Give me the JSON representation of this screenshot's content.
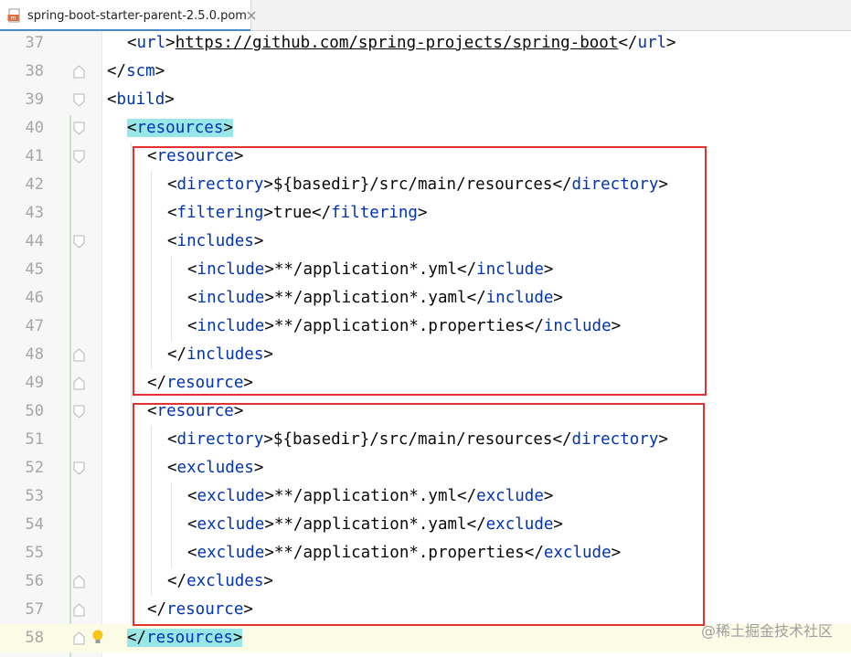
{
  "tab": {
    "title": "spring-boot-starter-parent-2.5.0.pom",
    "icon": "maven-pom-icon"
  },
  "lines": [
    {
      "num": "37",
      "indent": 1,
      "parts": [
        {
          "t": "<",
          "c": "p"
        },
        {
          "t": "url",
          "c": "tag"
        },
        {
          "t": ">",
          "c": "p"
        },
        {
          "t": "https://github.com/spring-projects/spring-boot",
          "c": "url"
        },
        {
          "t": "</",
          "c": "p"
        },
        {
          "t": "url",
          "c": "tag"
        },
        {
          "t": ">",
          "c": "p"
        }
      ]
    },
    {
      "num": "38",
      "indent": 0,
      "fold": "end",
      "parts": [
        {
          "t": "</",
          "c": "p"
        },
        {
          "t": "scm",
          "c": "tag"
        },
        {
          "t": ">",
          "c": "p"
        }
      ]
    },
    {
      "num": "39",
      "indent": 0,
      "fold": "start",
      "parts": [
        {
          "t": "<",
          "c": "p"
        },
        {
          "t": "build",
          "c": "tag"
        },
        {
          "t": ">",
          "c": "p"
        }
      ]
    },
    {
      "num": "40",
      "indent": 1,
      "fold": "start",
      "parts": [
        {
          "t": "<resources>",
          "c": "taghl"
        }
      ]
    },
    {
      "num": "41",
      "indent": 2,
      "fold": "start",
      "parts": [
        {
          "t": "<",
          "c": "p"
        },
        {
          "t": "resource",
          "c": "tag"
        },
        {
          "t": ">",
          "c": "p"
        }
      ]
    },
    {
      "num": "42",
      "indent": 3,
      "parts": [
        {
          "t": "<",
          "c": "p"
        },
        {
          "t": "directory",
          "c": "tag"
        },
        {
          "t": ">${basedir}/src/main/resources</",
          "c": "p"
        },
        {
          "t": "directory",
          "c": "tag"
        },
        {
          "t": ">",
          "c": "p"
        }
      ]
    },
    {
      "num": "43",
      "indent": 3,
      "parts": [
        {
          "t": "<",
          "c": "p"
        },
        {
          "t": "filtering",
          "c": "tag"
        },
        {
          "t": ">true</",
          "c": "p"
        },
        {
          "t": "filtering",
          "c": "tag"
        },
        {
          "t": ">",
          "c": "p"
        }
      ]
    },
    {
      "num": "44",
      "indent": 3,
      "fold": "start",
      "parts": [
        {
          "t": "<",
          "c": "p"
        },
        {
          "t": "includes",
          "c": "tag"
        },
        {
          "t": ">",
          "c": "p"
        }
      ]
    },
    {
      "num": "45",
      "indent": 4,
      "parts": [
        {
          "t": "<",
          "c": "p"
        },
        {
          "t": "include",
          "c": "tag"
        },
        {
          "t": ">**/application*.yml</",
          "c": "p"
        },
        {
          "t": "include",
          "c": "tag"
        },
        {
          "t": ">",
          "c": "p"
        }
      ]
    },
    {
      "num": "46",
      "indent": 4,
      "parts": [
        {
          "t": "<",
          "c": "p"
        },
        {
          "t": "include",
          "c": "tag"
        },
        {
          "t": ">**/application*.yaml</",
          "c": "p"
        },
        {
          "t": "include",
          "c": "tag"
        },
        {
          "t": ">",
          "c": "p"
        }
      ]
    },
    {
      "num": "47",
      "indent": 4,
      "parts": [
        {
          "t": "<",
          "c": "p"
        },
        {
          "t": "include",
          "c": "tag"
        },
        {
          "t": ">**/application*.properties</",
          "c": "p"
        },
        {
          "t": "include",
          "c": "tag"
        },
        {
          "t": ">",
          "c": "p"
        }
      ]
    },
    {
      "num": "48",
      "indent": 3,
      "fold": "end",
      "parts": [
        {
          "t": "</",
          "c": "p"
        },
        {
          "t": "includes",
          "c": "tag"
        },
        {
          "t": ">",
          "c": "p"
        }
      ]
    },
    {
      "num": "49",
      "indent": 2,
      "fold": "end",
      "parts": [
        {
          "t": "</",
          "c": "p"
        },
        {
          "t": "resource",
          "c": "tag"
        },
        {
          "t": ">",
          "c": "p"
        }
      ]
    },
    {
      "num": "50",
      "indent": 2,
      "fold": "start",
      "parts": [
        {
          "t": "<",
          "c": "p"
        },
        {
          "t": "resource",
          "c": "tag"
        },
        {
          "t": ">",
          "c": "p"
        }
      ]
    },
    {
      "num": "51",
      "indent": 3,
      "parts": [
        {
          "t": "<",
          "c": "p"
        },
        {
          "t": "directory",
          "c": "tag"
        },
        {
          "t": ">${basedir}/src/main/resources</",
          "c": "p"
        },
        {
          "t": "directory",
          "c": "tag"
        },
        {
          "t": ">",
          "c": "p"
        }
      ]
    },
    {
      "num": "52",
      "indent": 3,
      "fold": "start",
      "parts": [
        {
          "t": "<",
          "c": "p"
        },
        {
          "t": "excludes",
          "c": "tag"
        },
        {
          "t": ">",
          "c": "p"
        }
      ]
    },
    {
      "num": "53",
      "indent": 4,
      "parts": [
        {
          "t": "<",
          "c": "p"
        },
        {
          "t": "exclude",
          "c": "tag"
        },
        {
          "t": ">**/application*.yml</",
          "c": "p"
        },
        {
          "t": "exclude",
          "c": "tag"
        },
        {
          "t": ">",
          "c": "p"
        }
      ]
    },
    {
      "num": "54",
      "indent": 4,
      "parts": [
        {
          "t": "<",
          "c": "p"
        },
        {
          "t": "exclude",
          "c": "tag"
        },
        {
          "t": ">**/application*.yaml</",
          "c": "p"
        },
        {
          "t": "exclude",
          "c": "tag"
        },
        {
          "t": ">",
          "c": "p"
        }
      ]
    },
    {
      "num": "55",
      "indent": 4,
      "parts": [
        {
          "t": "<",
          "c": "p"
        },
        {
          "t": "exclude",
          "c": "tag"
        },
        {
          "t": ">**/application*.properties</",
          "c": "p"
        },
        {
          "t": "exclude",
          "c": "tag"
        },
        {
          "t": ">",
          "c": "p"
        }
      ]
    },
    {
      "num": "56",
      "indent": 3,
      "fold": "end",
      "parts": [
        {
          "t": "</",
          "c": "p"
        },
        {
          "t": "excludes",
          "c": "tag"
        },
        {
          "t": ">",
          "c": "p"
        }
      ]
    },
    {
      "num": "57",
      "indent": 2,
      "fold": "end",
      "parts": [
        {
          "t": "</",
          "c": "p"
        },
        {
          "t": "resource",
          "c": "tag"
        },
        {
          "t": ">",
          "c": "p"
        }
      ]
    },
    {
      "num": "58",
      "indent": 1,
      "fold": "end",
      "current": true,
      "bulb": true,
      "parts": [
        {
          "t": "</resources>",
          "c": "taghl"
        }
      ]
    }
  ],
  "colors": {
    "tag": "#0033b3",
    "text": "#080808",
    "tag_highlight": "#99e6e6",
    "annotation_box": "#e53030"
  },
  "watermark": "@稀土掘金技术社区"
}
